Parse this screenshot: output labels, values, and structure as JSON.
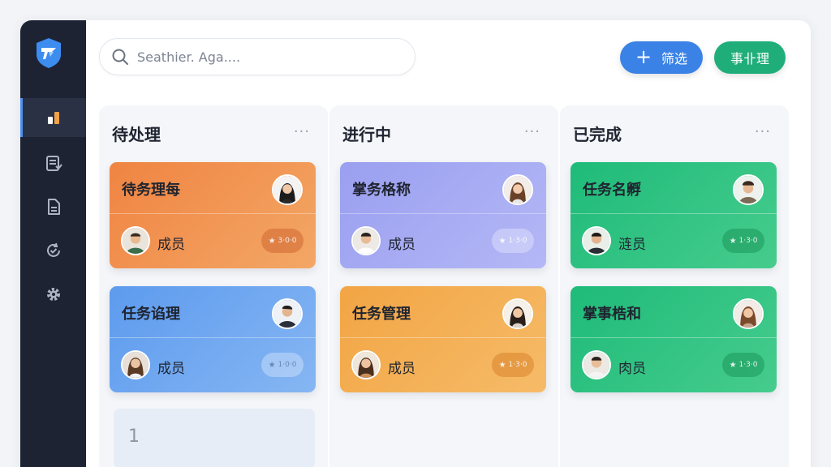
{
  "search": {
    "placeholder": "Seathier. Aga...."
  },
  "toolbar": {
    "filter_label": "筛选",
    "plus": "+",
    "manage_label": "事卝理"
  },
  "sidebar": {
    "items": [
      {
        "icon": "bar-chart-icon",
        "active": true
      },
      {
        "icon": "task-list-icon",
        "active": false
      },
      {
        "icon": "document-icon",
        "active": false
      },
      {
        "icon": "refresh-check-icon",
        "active": false
      },
      {
        "icon": "gear-icon",
        "active": false
      }
    ]
  },
  "columns": [
    {
      "title": "待处理",
      "more": "···",
      "cards": [
        {
          "title": "待务理每",
          "member": "成员",
          "badge": "3·0·0",
          "color": "#f08442"
        },
        {
          "title": "任务谄理",
          "member": "成员",
          "badge": "1·0·0",
          "color": "#5d9bee"
        }
      ],
      "placeholder": "1"
    },
    {
      "title": "进行中",
      "more": "···",
      "cards": [
        {
          "title": "掌务格称",
          "member": "成员",
          "badge": "1·3·0",
          "color": "#9a9ff0"
        },
        {
          "title": "任务管理",
          "member": "成员",
          "badge": "1·3·0",
          "color": "#f2a544"
        }
      ]
    },
    {
      "title": "已完成",
      "more": "···",
      "cards": [
        {
          "title": "任务名孵",
          "member": "涟员",
          "badge": "1·3·0",
          "color": "#1fbb79"
        },
        {
          "title": "掌事梏和",
          "member": "肉员",
          "badge": "1·3·0",
          "color": "#1fbb79"
        }
      ]
    }
  ]
}
